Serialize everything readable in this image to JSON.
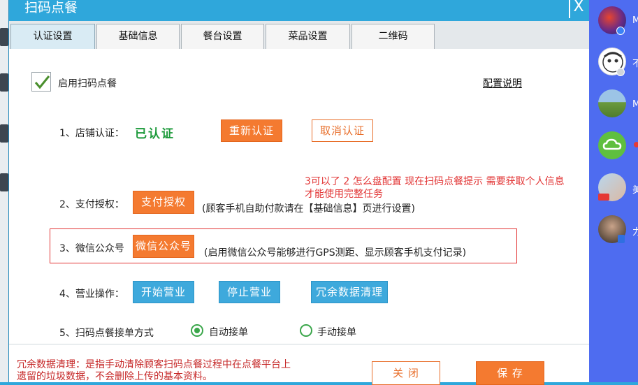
{
  "dialog": {
    "title": "扫码点餐",
    "close_glyph": "X"
  },
  "tabs": [
    {
      "label": "认证设置",
      "active": true
    },
    {
      "label": "基础信息",
      "active": false
    },
    {
      "label": "餐台设置",
      "active": false
    },
    {
      "label": "菜品设置",
      "active": false
    },
    {
      "label": "二维码",
      "active": false
    }
  ],
  "enable": {
    "label": "启用扫码点餐",
    "checked": true
  },
  "config_link": "配置说明",
  "rows": {
    "store_auth": {
      "label": "1、店铺认证：",
      "status": "已认证",
      "reauth_button": "重新认证",
      "cancel_button": "取消认证"
    },
    "pay_auth": {
      "label": "2、支付授权：",
      "button": "支付授权",
      "hint": "(顾客手机自助付款请在【基础信息】页进行设置)"
    },
    "wechat": {
      "label": "3、微信公众号",
      "button": "微信公众号",
      "hint": "(启用微信公众号能够进行GPS测距、显示顾客手机支付记录)"
    },
    "business": {
      "label": "4、营业操作：",
      "start_button": "开始营业",
      "stop_button": "停止营业",
      "clean_button": "冗余数据清理"
    },
    "order_mode": {
      "label": "5、扫码点餐接单方式",
      "auto_label": "自动接单",
      "manual_label": "手动接单",
      "selected": "auto"
    }
  },
  "annotation": {
    "line1": "3可以了   2   怎么盘配置   现在扫码点餐提示  需要获取个人信息",
    "line2": "才能使用完整任务"
  },
  "footer": {
    "note_line1": "冗余数据清理：是指手动清除顾客扫码点餐过程中在点餐平台上",
    "note_line2": "遗留的垃圾数据，不会删除上传的基本资料。",
    "close_button": "关 闭",
    "save_button": "保 存"
  },
  "contacts": [
    {
      "name_fragment": "M",
      "avatar": "colorful-avatar",
      "badge": "star-badge"
    },
    {
      "name_fragment": "不",
      "avatar": "cartoon-avatar",
      "badge": "time-badge"
    },
    {
      "name_fragment": "M",
      "avatar": "landscape-avatar",
      "badge": ""
    },
    {
      "name_fragment": "",
      "avatar": "cloud-icon-avatar",
      "badge": "red-dot"
    },
    {
      "name_fragment": "美",
      "avatar": "street-avatar",
      "badge": "hot-badge"
    },
    {
      "name_fragment": "力",
      "avatar": "man-avatar",
      "badge": "phone-badge"
    }
  ],
  "colors": {
    "accent_blue": "#2fa7db",
    "orange": "#f47a30",
    "verified_green": "#1d9a3b",
    "annotation_red": "#e23535",
    "panel_blue": "#4e6cf0"
  }
}
